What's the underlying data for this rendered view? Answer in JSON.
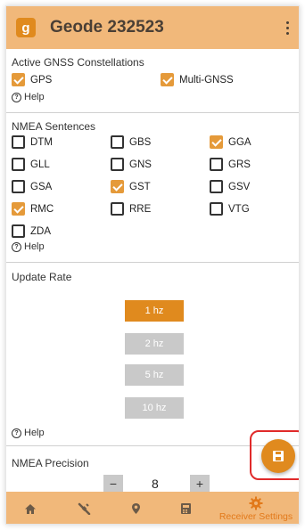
{
  "app": {
    "logo_letter": "g",
    "title": "Geode 232523"
  },
  "constellations": {
    "title": "Active GNSS Constellations",
    "items": [
      {
        "label": "GPS",
        "checked": true
      },
      {
        "label": "Multi-GNSS",
        "checked": true
      }
    ],
    "help": "Help"
  },
  "nmea": {
    "title": "NMEA Sentences",
    "items": [
      {
        "label": "DTM",
        "checked": false
      },
      {
        "label": "GBS",
        "checked": false
      },
      {
        "label": "GGA",
        "checked": true
      },
      {
        "label": "GLL",
        "checked": false
      },
      {
        "label": "GNS",
        "checked": false
      },
      {
        "label": "GRS",
        "checked": false
      },
      {
        "label": "GSA",
        "checked": false
      },
      {
        "label": "GST",
        "checked": true
      },
      {
        "label": "GSV",
        "checked": false
      },
      {
        "label": "RMC",
        "checked": true
      },
      {
        "label": "RRE",
        "checked": false
      },
      {
        "label": "VTG",
        "checked": false
      },
      {
        "label": "ZDA",
        "checked": false
      }
    ],
    "help": "Help"
  },
  "update_rate": {
    "title": "Update Rate",
    "options": [
      {
        "label": "1 hz",
        "selected": true
      },
      {
        "label": "2 hz",
        "selected": false
      },
      {
        "label": "5 hz",
        "selected": false
      },
      {
        "label": "10 hz",
        "selected": false
      }
    ],
    "help": "Help"
  },
  "precision": {
    "title": "NMEA Precision",
    "minus": "−",
    "value": "8",
    "plus": "+"
  },
  "nav": {
    "items": [
      {
        "icon": "home-icon",
        "label": ""
      },
      {
        "icon": "satellite-icon",
        "label": ""
      },
      {
        "icon": "location-pin-icon",
        "label": ""
      },
      {
        "icon": "calculator-icon",
        "label": ""
      },
      {
        "icon": "gear-icon",
        "label": "Receiver Settings"
      }
    ]
  },
  "colors": {
    "accent": "#e08a1e",
    "appbar": "#f1b87a",
    "checkbox": "#e59a3a",
    "highlight_ring": "#e02a2a",
    "disabled": "#c9c9c9"
  }
}
